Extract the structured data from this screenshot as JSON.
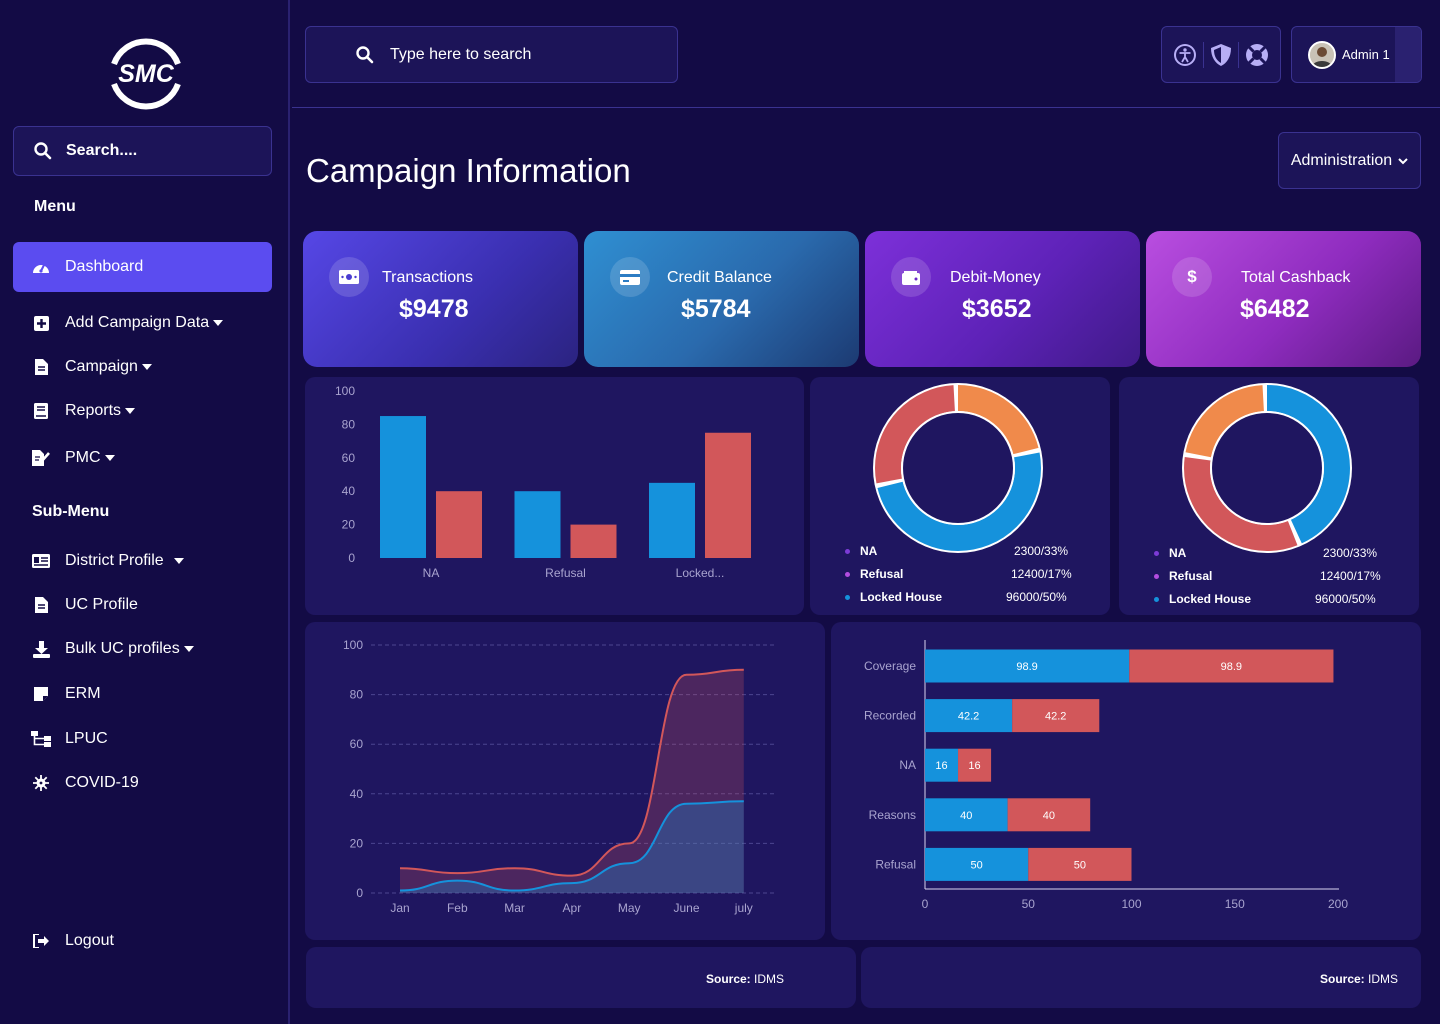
{
  "sidebar": {
    "logo_text": "SMC",
    "search_placeholder": "Search....",
    "menu_title": "Menu",
    "submenu_title": "Sub-Menu",
    "menu_items": [
      {
        "label": "Dashboard",
        "icon": "dashboard-icon",
        "active": true
      },
      {
        "label": "Add Campaign Data",
        "icon": "plus-square-icon",
        "caret": true
      },
      {
        "label": "Campaign",
        "icon": "file-icon",
        "caret": true
      },
      {
        "label": "Reports",
        "icon": "book-icon",
        "caret": true
      },
      {
        "label": "PMC",
        "icon": "edit-file-icon",
        "caret": true
      }
    ],
    "submenu_items": [
      {
        "label": "District Profile",
        "icon": "id-card-icon",
        "caret": true
      },
      {
        "label": "UC Profile",
        "icon": "file-icon"
      },
      {
        "label": "Bulk UC profiles",
        "icon": "download-icon",
        "caret": true
      },
      {
        "label": "ERM",
        "icon": "sticky-note-icon"
      },
      {
        "label": "LPUC",
        "icon": "sitemap-icon"
      },
      {
        "label": "COVID-19",
        "icon": "virus-icon"
      }
    ],
    "logout_label": "Logout"
  },
  "topbar": {
    "search_placeholder": "Type here to search",
    "icons": [
      "accessibility-icon",
      "shield-icon",
      "lifebuoy-icon"
    ],
    "user_name": "Admin 1"
  },
  "page": {
    "title": "Campaign Information",
    "admin_select": "Administration"
  },
  "cards": [
    {
      "label": "Transactions",
      "value": "$9478",
      "icon": "money-bill-icon"
    },
    {
      "label": "Credit Balance",
      "value": "$5784",
      "icon": "credit-card-icon"
    },
    {
      "label": "Debit-Money",
      "value": "$3652",
      "icon": "wallet-icon"
    },
    {
      "label": "Total Cashback",
      "value": "$6482",
      "icon": "dollar-icon"
    }
  ],
  "colors": {
    "blue": "#1592dc",
    "red": "#d2575a",
    "orange": "#f08a4b",
    "purple": "#7c3bd6"
  },
  "chart_data": [
    {
      "type": "bar",
      "categories": [
        "NA",
        "Refusal",
        "Locked..."
      ],
      "series": [
        {
          "values": [
            85,
            40,
            45
          ]
        },
        {
          "values": [
            40,
            20,
            75
          ]
        }
      ],
      "ylim": [
        0,
        100
      ],
      "yticks": [
        0,
        20,
        40,
        60,
        80,
        100
      ]
    },
    {
      "type": "pie",
      "labels": [
        "NA",
        "Refusal",
        "Locked House"
      ],
      "values_text": [
        "2300/33%",
        "12400/17%",
        "96000/50%"
      ],
      "segments": [
        {
          "color": "#f08a4b",
          "fraction": 0.22
        },
        {
          "color": "#1592dc",
          "fraction": 0.5
        },
        {
          "color": "#d2575a",
          "fraction": 0.28
        }
      ]
    },
    {
      "type": "pie",
      "labels": [
        "NA",
        "Refusal",
        "Locked House"
      ],
      "values_text": [
        "2300/33%",
        "12400/17%",
        "96000/50%"
      ],
      "segments": [
        {
          "color": "#1592dc",
          "fraction": 0.44
        },
        {
          "color": "#d2575a",
          "fraction": 0.34
        },
        {
          "color": "#f08a4b",
          "fraction": 0.22
        }
      ]
    },
    {
      "type": "area",
      "x": [
        "Jan",
        "Feb",
        "Mar",
        "Apr",
        "May",
        "June",
        "july"
      ],
      "series": [
        {
          "values": [
            10,
            8,
            10,
            7,
            20,
            88,
            90
          ]
        },
        {
          "values": [
            1,
            5,
            1,
            4,
            12,
            36,
            37
          ]
        }
      ],
      "ylim": [
        0,
        100
      ],
      "yticks": [
        0,
        20,
        40,
        60,
        80,
        100
      ]
    },
    {
      "type": "bar",
      "orientation": "horizontal",
      "stacked": true,
      "categories": [
        "Coverage",
        "Recorded",
        "NA",
        "Reasons",
        "Refusal"
      ],
      "series": [
        {
          "values": [
            98.9,
            42.2,
            16,
            40,
            50
          ]
        },
        {
          "values": [
            98.9,
            42.2,
            16,
            40,
            50
          ]
        }
      ],
      "xlim": [
        0,
        200
      ],
      "xticks": [
        0,
        50,
        100,
        150,
        200
      ]
    }
  ],
  "sources": [
    {
      "label": "Source:",
      "value": "IDMS"
    },
    {
      "label": "Source:",
      "value": "IDMS"
    }
  ]
}
